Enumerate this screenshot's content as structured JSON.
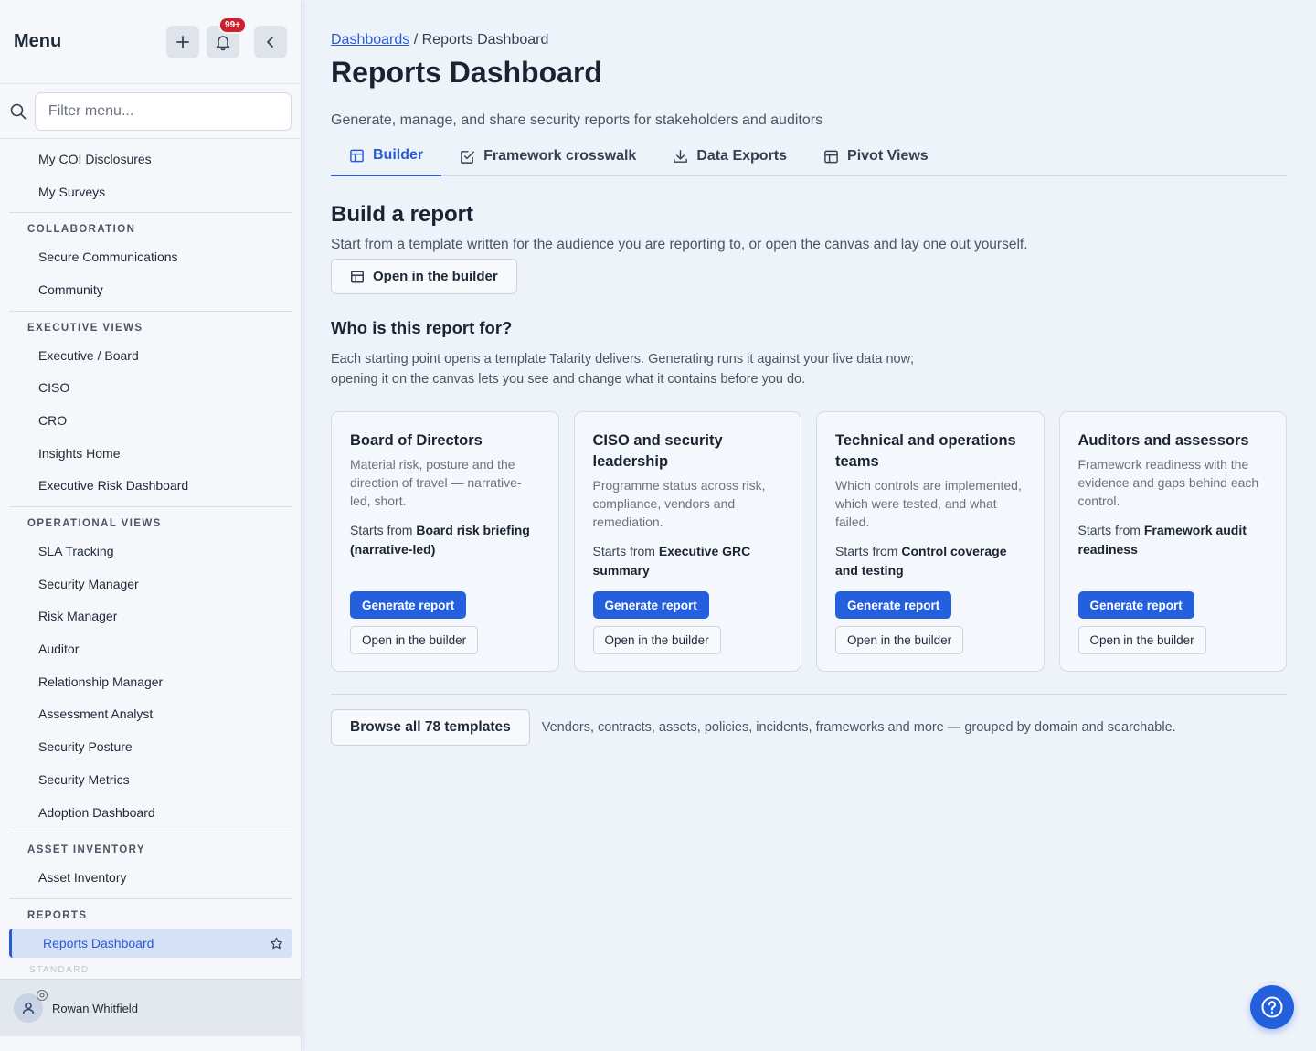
{
  "sidebar": {
    "title": "Menu",
    "notification_badge": "99+",
    "filter_placeholder": "Filter menu...",
    "top_items": [
      "My COI Disclosures",
      "My Surveys"
    ],
    "sections": [
      {
        "label": "COLLABORATION",
        "items": [
          "Secure Communications",
          "Community"
        ]
      },
      {
        "label": "EXECUTIVE VIEWS",
        "items": [
          "Executive / Board",
          "CISO",
          "CRO",
          "Insights Home",
          "Executive Risk Dashboard"
        ]
      },
      {
        "label": "OPERATIONAL VIEWS",
        "items": [
          "SLA Tracking",
          "Security Manager",
          "Risk Manager",
          "Auditor",
          "Relationship Manager",
          "Assessment Analyst",
          "Security Posture",
          "Security Metrics",
          "Adoption Dashboard"
        ]
      },
      {
        "label": "ASSET INVENTORY",
        "items": [
          "Asset Inventory"
        ]
      },
      {
        "label": "REPORTS",
        "items": []
      }
    ],
    "active_item": "Reports Dashboard",
    "faded_section": "STANDARD",
    "user_name": "Rowan Whitfield"
  },
  "breadcrumb": {
    "link": "Dashboards",
    "separator": " / ",
    "current": "Reports Dashboard"
  },
  "page": {
    "title": "Reports Dashboard",
    "subtitle": "Generate, manage, and share security reports for stakeholders and auditors"
  },
  "tabs": [
    "Builder",
    "Framework crosswalk",
    "Data Exports",
    "Pivot Views"
  ],
  "build": {
    "title": "Build a report",
    "desc": "Start from a template written for the audience you are reporting to, or open the canvas and lay one out yourself.",
    "open_builder": "Open in the builder"
  },
  "who": {
    "title": "Who is this report for?",
    "desc_line1": "Each starting point opens a template Talarity delivers. Generating runs it against your live data now;",
    "desc_line2": "opening it on the canvas lets you see and change what it contains before you do."
  },
  "cards": [
    {
      "title": "Board of Directors",
      "desc": "Material risk, posture and the direction of travel — narrative-led, short.",
      "starts_prefix": "Starts from ",
      "template": "Board risk briefing (narrative-led)",
      "generate": "Generate report",
      "open": "Open in the builder"
    },
    {
      "title": "CISO and security leadership",
      "desc": "Programme status across risk, compliance, vendors and remediation.",
      "starts_prefix": "Starts from ",
      "template": "Executive GRC summary",
      "generate": "Generate report",
      "open": "Open in the builder"
    },
    {
      "title": "Technical and operations teams",
      "desc": "Which controls are implemented, which were tested, and what failed.",
      "starts_prefix": "Starts from ",
      "template": "Control coverage and testing",
      "generate": "Generate report",
      "open": "Open in the builder"
    },
    {
      "title": "Auditors and assessors",
      "desc": "Framework readiness with the evidence and gaps behind each control.",
      "starts_prefix": "Starts from ",
      "template": "Framework audit readiness",
      "generate": "Generate report",
      "open": "Open in the builder"
    }
  ],
  "browse": {
    "button": "Browse all 78 templates",
    "desc": "Vendors, contracts, assets, policies, incidents, frameworks and more — grouped by domain and searchable."
  },
  "colors": {
    "accent": "#2460de",
    "active_nav_bg": "#d4e1f7",
    "badge": "#d01f2f",
    "background": "#eef2f9"
  }
}
